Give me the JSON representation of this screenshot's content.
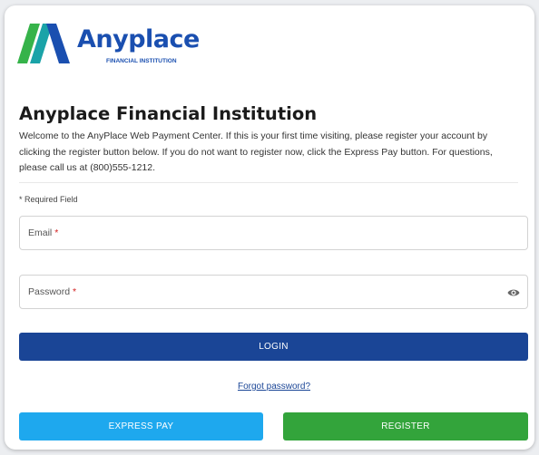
{
  "brand": {
    "name": "Anyplace",
    "subtitle": "FINANCIAL INSTITUTION",
    "colors": {
      "dark_blue": "#1a4fb0",
      "teal": "#1aa3a8",
      "green": "#36b34a"
    }
  },
  "header": {
    "title": "Anyplace Financial Institution",
    "welcome": "Welcome to the AnyPlace Web Payment Center. If this is your first time visiting, please register your account by clicking the register button below. If you do not want to register now, click the Express Pay button. For questions, please call us at (800)555-1212."
  },
  "form": {
    "required_note": "* Required Field",
    "email_label": "Email",
    "password_label": "Password",
    "required_marker": "*",
    "login_label": "LOGIN",
    "forgot_label": "Forgot password?"
  },
  "actions": {
    "express_pay_label": "EXPRESS PAY",
    "register_label": "REGISTER"
  },
  "icons": {
    "password_toggle": "eye-icon"
  },
  "colors": {
    "login_button": "#1a4596",
    "express_pay_button": "#1ea8ee",
    "register_button": "#33a43b",
    "required_star": "#d32020"
  }
}
